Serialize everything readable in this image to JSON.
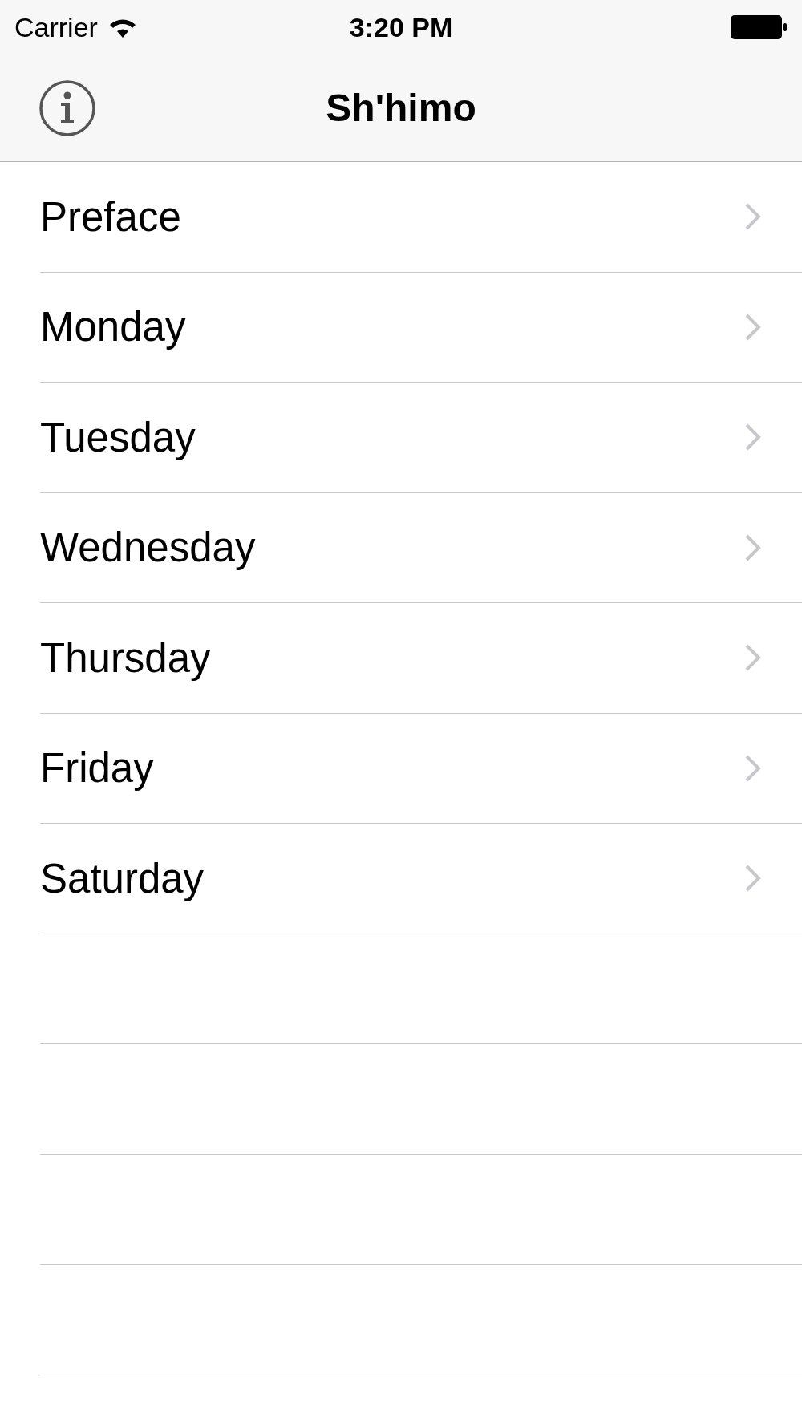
{
  "status_bar": {
    "carrier": "Carrier",
    "time": "3:20 PM"
  },
  "nav_bar": {
    "title": "Sh'himo"
  },
  "rows": [
    {
      "label": "Preface"
    },
    {
      "label": "Monday"
    },
    {
      "label": "Tuesday"
    },
    {
      "label": "Wednesday"
    },
    {
      "label": "Thursday"
    },
    {
      "label": "Friday"
    },
    {
      "label": "Saturday"
    }
  ]
}
